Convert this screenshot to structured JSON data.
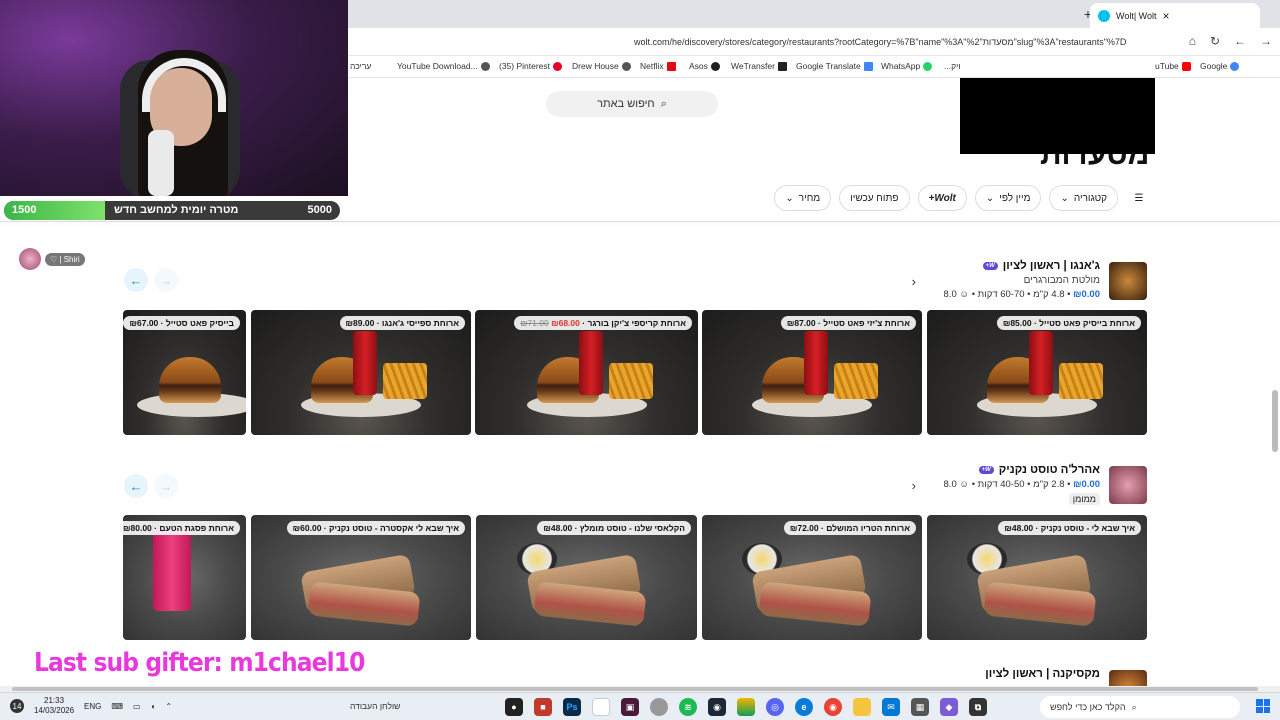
{
  "browser": {
    "tab_title": "Wolt| Wolt",
    "url": "wolt.com/he/discovery/stores/category/restaurants?rootCategory=%7B\"name\"%3A\"%2\"מסעדות\"slug\"%3A\"restaurants\"%7D",
    "bookmarks": [
      "עריכה",
      "YouTube Download...",
      "(35) Pinterest",
      "Drew House",
      "Netflix",
      "Asos",
      "WeTransfer",
      "Google Translate",
      "WhatsApp",
      "...ויק",
      "uTube",
      "Google"
    ]
  },
  "page": {
    "search_placeholder": "חיפוש באתר",
    "title": "מסעדות",
    "filters": [
      "קטגוריה",
      "מיין לפי",
      "Wolt+",
      "פתוח עכשיו",
      "מחיר"
    ]
  },
  "restaurants": [
    {
      "name": "ג'אנגו | ראשון לציון",
      "badge": "W+",
      "subtitle": "מולטת המבורגרים",
      "meta_fee": "₪0.00",
      "meta_rest": "4.8 ק\"מ • 60-70 דקות • ☺ 8.0",
      "items": [
        {
          "label": "ארוחת בייסיק פאט סטייל",
          "price": "₪85.00"
        },
        {
          "label": "ארוחת צ'יזי פאט סטייל",
          "price": "₪87.00"
        },
        {
          "label": "ארוחת קריספי צ'יקן בורגר",
          "price": "₪68.00",
          "old_price": "₪71.00"
        },
        {
          "label": "ארוחת ספייסי ג'אנגו",
          "price": "₪89.00"
        },
        {
          "label": "בייסיק פאט סטייל",
          "price": "₪67.00"
        }
      ]
    },
    {
      "name": "אהרל'ה טוסט נקניק",
      "badge": "W+",
      "meta_fee": "₪0.00",
      "meta_rest": "2.8 ק\"מ • 40-50 דקות • ☺ 8.0",
      "tag": "ממומן",
      "items": [
        {
          "label": "איך שבא לי - טוסט נקניק",
          "price": "₪48.00"
        },
        {
          "label": "ארוחת הטריו המושלם",
          "price": "₪72.00"
        },
        {
          "label": "הקלאסי שלנו - טוסט מומלץ",
          "price": "₪48.00"
        },
        {
          "label": "איך שבא לי אקסטרה - טוסט נקניק",
          "price": "₪60.00"
        },
        {
          "label": "ארוחת פסגת הטעם",
          "price": "₪80.00"
        }
      ]
    },
    {
      "name": "מקסיקנה | ראשון לציון"
    }
  ],
  "stream": {
    "goal_current": "1500",
    "goal_target": "5000",
    "goal_progress": 0.3,
    "goal_text": "מטרה יומית למחשב חדש",
    "chat_user": "Shiri",
    "last_gifter": "Last sub gifter: m1chael10"
  },
  "taskbar": {
    "time": "21:33",
    "date": "14/03/2026",
    "lang": "ENG",
    "desktop_label": "שולחן העבודה",
    "search_placeholder": "הקלד כאן כדי לחפש",
    "notification_count": "14"
  }
}
